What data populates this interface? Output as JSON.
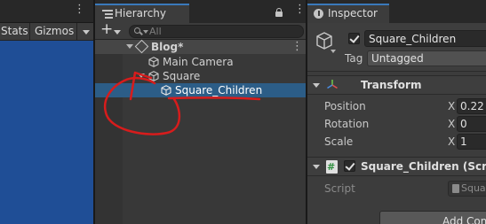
{
  "scene_panel": {
    "stats_label": "Stats",
    "gizmos_label": "Gizmos"
  },
  "hierarchy": {
    "tab_label": "Hierarchy",
    "search_placeholder": "All",
    "scene_name": "Blog*",
    "items": [
      {
        "label": "Main Camera"
      },
      {
        "label": "Square"
      },
      {
        "label": "Square_Children",
        "selected": true
      }
    ]
  },
  "inspector": {
    "tab_label": "Inspector",
    "object_name": "Square_Children",
    "active": true,
    "tag_label": "Tag",
    "tag_value": "Untagged",
    "transform": {
      "title": "Transform",
      "rows": [
        {
          "label": "Position",
          "axis": "X",
          "value": "0.22"
        },
        {
          "label": "Rotation",
          "axis": "X",
          "value": "0"
        },
        {
          "label": "Scale",
          "axis": "X",
          "value": "1"
        }
      ]
    },
    "script_component": {
      "title": "Square_Children (Script)",
      "enabled": true,
      "script_label": "Script",
      "script_value": "Squa"
    },
    "add_component_label": "Add Com"
  },
  "colors": {
    "selection": "#2c5d87",
    "tab_accent": "#3a79bb",
    "scene_view": "#1f4e96",
    "annotation": "#d71c1c"
  }
}
